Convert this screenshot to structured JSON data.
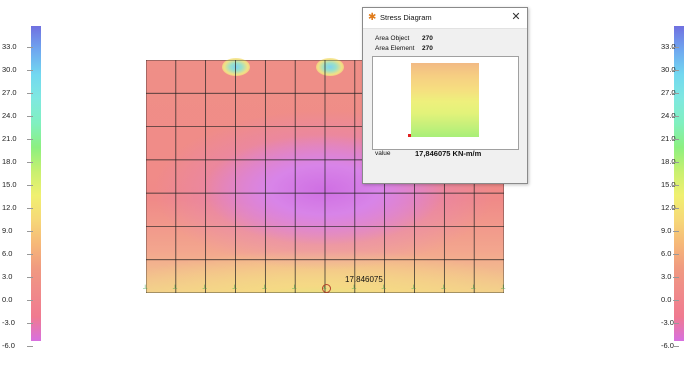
{
  "legend": {
    "ticks": [
      "33.0",
      "30.0",
      "27.0",
      "24.0",
      "21.0",
      "18.0",
      "15.0",
      "12.0",
      "9.0",
      "6.0",
      "3.0",
      "0.0",
      "-3.0",
      "-6.0"
    ],
    "colors": [
      "#7070e0",
      "#6fa8f0",
      "#72d8f0",
      "#7fe8e0",
      "#80f0c0",
      "#8cf080",
      "#c8f070",
      "#f0f070",
      "#f6d878",
      "#f6b878",
      "#f09a80",
      "#f08a8a",
      "#f07a90",
      "#d870e0"
    ]
  },
  "diagram": {
    "value_label": "17.846075",
    "support_label": "┴"
  },
  "dialog": {
    "title": "Stress Diagram",
    "close_symbol": "✕",
    "area_object_label": "Area Object",
    "area_object_value": "270",
    "area_element_label": "Area Element",
    "area_element_value": "270",
    "value_label": "value",
    "value_text": "17,846075  KN-m/m"
  }
}
